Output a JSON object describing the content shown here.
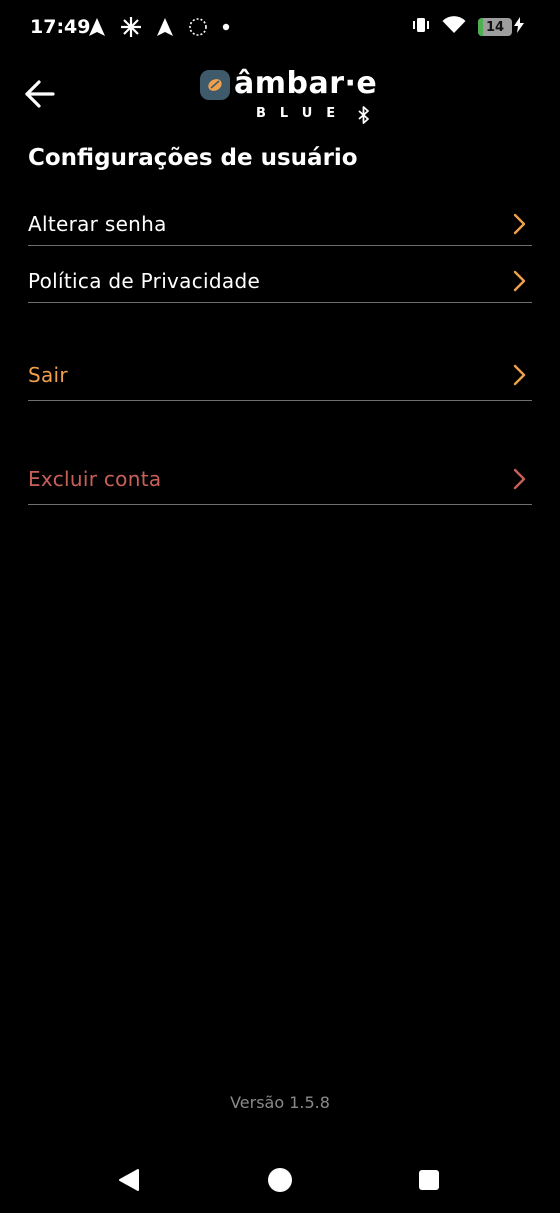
{
  "status_bar": {
    "time": "17:49",
    "battery_level": "14",
    "battery_percent": 14,
    "icons_left": [
      "navigation-arrow-icon",
      "sparkle-icon",
      "navigation-arrow-icon",
      "dotted-circle-icon",
      "dot-icon"
    ],
    "icons_right": [
      "vibrate-icon",
      "wifi-icon",
      "battery-icon",
      "charging-icon"
    ]
  },
  "header": {
    "logo_text": "âmbar·e",
    "logo_subtext": "BLUE",
    "back_icon": "arrow-left-icon"
  },
  "page_title": "Configurações de usuário",
  "menu": {
    "items": [
      {
        "label": "Alterar senha",
        "color": "#ffffff"
      },
      {
        "label": "Política de Privacidade",
        "color": "#ffffff"
      },
      {
        "label": "Sair",
        "color": "#f0a04b"
      },
      {
        "label": "Excluir conta",
        "color": "#c8605a"
      }
    ],
    "chevron_color": "#f0a04b"
  },
  "footer": {
    "version": "Versão 1.5.8"
  },
  "nav_bar": {
    "icons": [
      "nav-back-icon",
      "nav-home-icon",
      "nav-recents-icon"
    ]
  }
}
